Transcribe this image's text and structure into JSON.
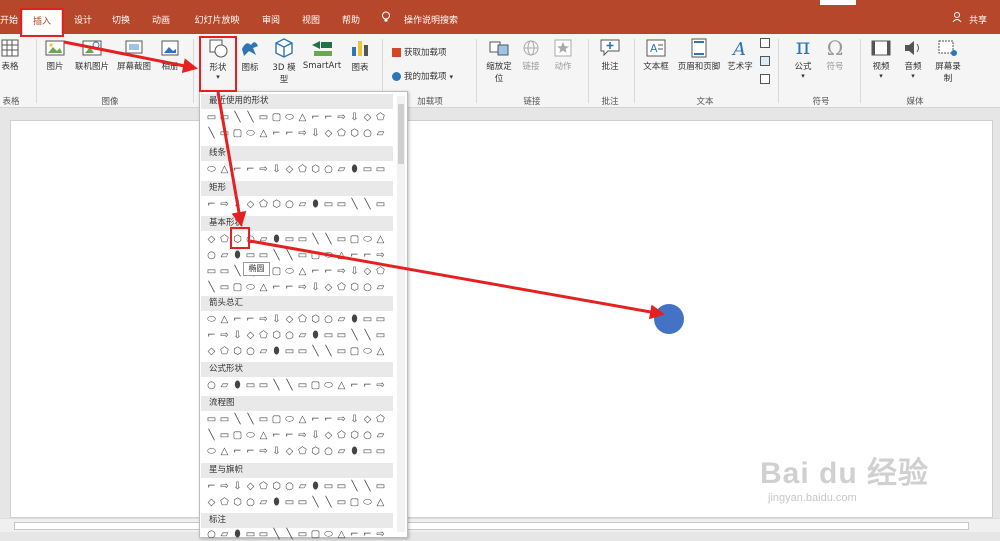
{
  "tabs": [
    {
      "label": "开始"
    },
    {
      "label": "插入"
    },
    {
      "label": "设计"
    },
    {
      "label": "切换"
    },
    {
      "label": "动画"
    },
    {
      "label": "幻灯片放映"
    },
    {
      "label": "审阅"
    },
    {
      "label": "视图"
    },
    {
      "label": "帮助"
    },
    {
      "label": "操作说明搜索"
    }
  ],
  "share_label": "共享",
  "ribbon": {
    "table": {
      "label": "表格",
      "group": "表格"
    },
    "images": {
      "picture": "图片",
      "online_picture": "联机图片",
      "screenshot": "屏幕截图",
      "album": "相册",
      "group": "图像"
    },
    "illustrations": {
      "shapes": "形状",
      "icons": "图标",
      "model3d": "3D 模型",
      "smartart": "SmartArt",
      "chart": "图表"
    },
    "addins": {
      "get": "获取加载项",
      "mine": "我的加载项",
      "group": "加载项"
    },
    "links": {
      "zoom": "缩放定位",
      "link": "链接",
      "action": "动作",
      "group": "链接"
    },
    "comments": {
      "comment": "批注",
      "group": "批注"
    },
    "text": {
      "textbox": "文本框",
      "header_footer": "页眉和页脚",
      "wordart": "艺术字",
      "group": "文本"
    },
    "symbols": {
      "equation": "公式",
      "symbol": "符号",
      "group": "符号"
    },
    "media": {
      "video": "视频",
      "audio": "音频",
      "screen_record": "屏幕录制",
      "group": "媒体"
    }
  },
  "gallery": {
    "sections": [
      {
        "title": "最近使用的形状"
      },
      {
        "title": "线条"
      },
      {
        "title": "矩形"
      },
      {
        "title": "基本形状"
      },
      {
        "title": "箭头总汇"
      },
      {
        "title": "公式形状"
      },
      {
        "title": "流程图"
      },
      {
        "title": "星与旗帜"
      },
      {
        "title": "标注"
      }
    ],
    "tooltip": "椭圆"
  },
  "colors": {
    "accent": "#b7472a",
    "highlight": "#e62020",
    "circle": "#4472c4"
  },
  "watermark": {
    "main": "Bai du 经验",
    "sub": "jingyan.baidu.com"
  }
}
